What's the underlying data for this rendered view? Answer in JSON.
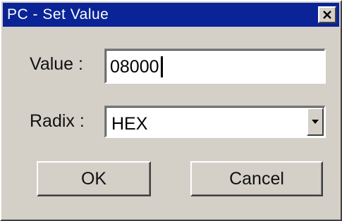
{
  "window": {
    "title": "PC - Set Value",
    "close_icon": "close-icon"
  },
  "form": {
    "value_label": "Value :",
    "value_text": "08000",
    "radix_label": "Radix :",
    "radix_selected": "HEX",
    "dropdown_icon": "dropdown-arrow-icon"
  },
  "buttons": {
    "ok_label": "OK",
    "cancel_label": "Cancel"
  },
  "colors": {
    "titlebar": "#0a2497",
    "dialog_background": "#d4d0c8",
    "field_background": "#ffffff"
  }
}
